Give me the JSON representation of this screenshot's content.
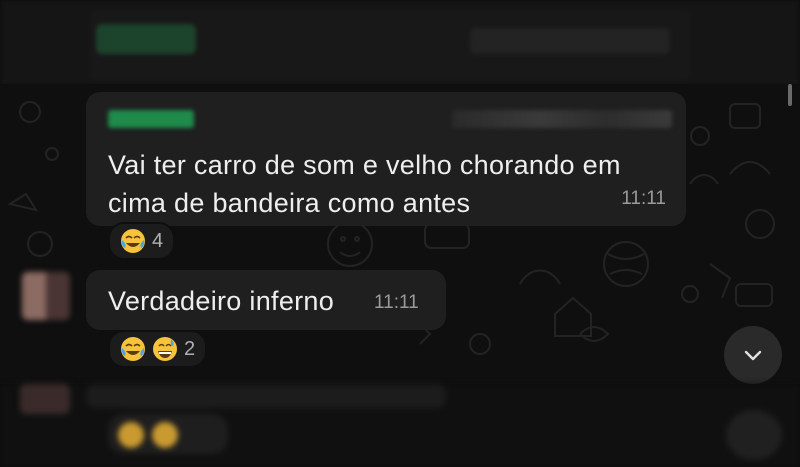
{
  "colors": {
    "background": "#0f0f0f",
    "bubble": "#1f1f1f",
    "text": "#eeeeee",
    "timestamp": "#9a9a9a",
    "sender_name_blurred": "#1f8a4a"
  },
  "messages": [
    {
      "text": "Vai ter carro de som e velho chorando em cima de bandeira como antes",
      "time": "11:11",
      "reaction": {
        "emojis": [
          "face-with-tears-of-joy"
        ],
        "count": "4"
      }
    },
    {
      "text": "Verdadeiro inferno",
      "time": "11:11",
      "reaction": {
        "emojis": [
          "face-with-tears-of-joy",
          "grinning-face-with-sweat"
        ],
        "count": "2"
      }
    }
  ],
  "icons": {
    "scroll_down": "chevron-down-icon"
  }
}
